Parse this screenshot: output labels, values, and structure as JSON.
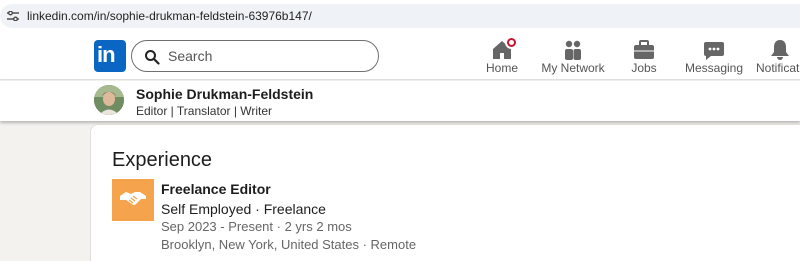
{
  "browser": {
    "url": "linkedin.com/in/sophie-drukman-feldstein-63976b147/"
  },
  "nav": {
    "logo_text": "in",
    "search_placeholder": "Search",
    "items": [
      {
        "label": "Home",
        "icon": "home-icon",
        "badge": true
      },
      {
        "label": "My Network",
        "icon": "people-icon"
      },
      {
        "label": "Jobs",
        "icon": "briefcase-icon"
      },
      {
        "label": "Messaging",
        "icon": "chat-icon"
      },
      {
        "label": "Notifications",
        "icon": "bell-icon"
      }
    ]
  },
  "profile": {
    "name": "Sophie Drukman-Feldstein",
    "headline": "Editor | Translator | Writer"
  },
  "experience": {
    "section_title": "Experience",
    "entries": [
      {
        "title": "Freelance Editor",
        "employment": "Self Employed · Freelance",
        "dates": "Sep 2023 - Present · 2 yrs 2 mos",
        "location": "Brooklyn, New York, United States · Remote",
        "logo_color": "#f5a34d",
        "logo_icon": "handshake-icon"
      }
    ]
  },
  "colors": {
    "brand": "#0a66c2",
    "badge": "#cb112d"
  }
}
